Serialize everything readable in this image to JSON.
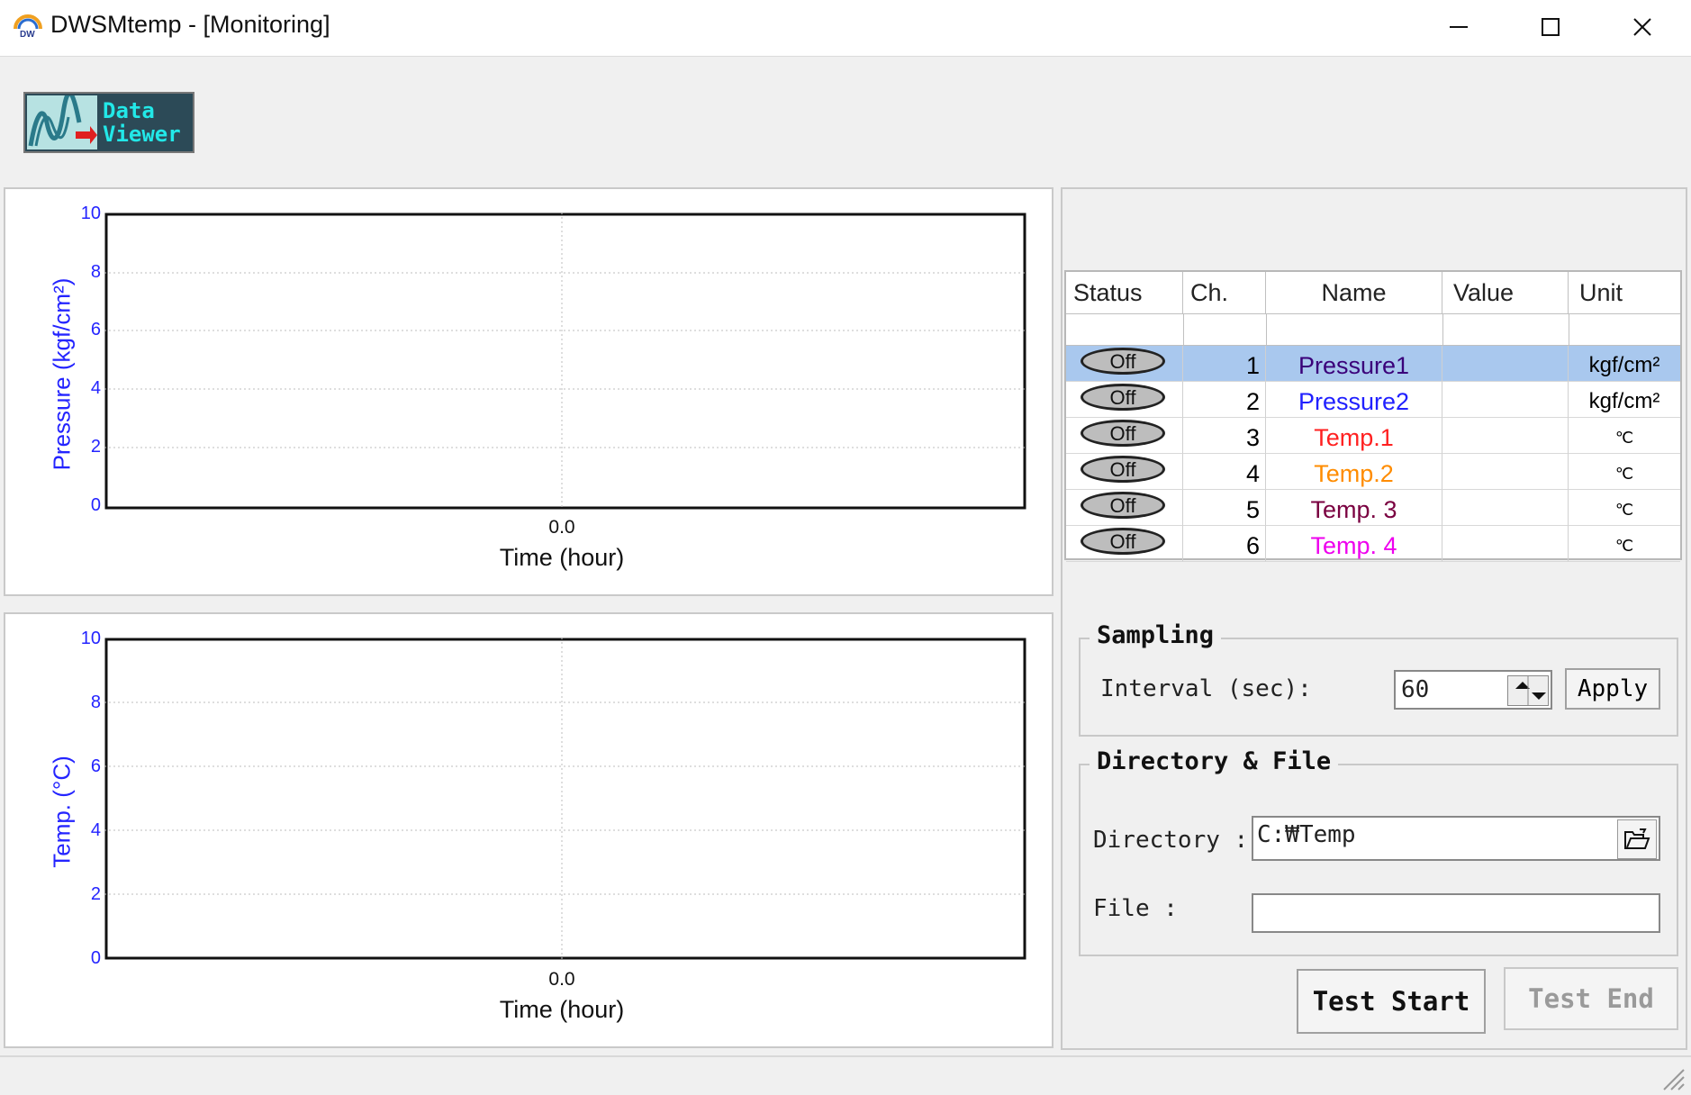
{
  "window": {
    "title": "DWSMtemp - [Monitoring]",
    "app_icon_text": "DW"
  },
  "logo": {
    "line1": "Data",
    "line2": "Viewer"
  },
  "charts": {
    "pressure": {
      "ylabel": "Pressure (kgf/cm²)",
      "xlabel": "Time (hour)",
      "xtick": "0.0",
      "yticks": [
        "10",
        "8",
        "6",
        "4",
        "2",
        "0"
      ]
    },
    "temp": {
      "ylabel": "Temp. (°C)",
      "xlabel": "Time (hour)",
      "xtick": "0.0",
      "yticks": [
        "10",
        "8",
        "6",
        "4",
        "2",
        "0"
      ]
    }
  },
  "chart_data": [
    {
      "type": "line",
      "ylabel": "Pressure (kgf/cm²)",
      "xlabel": "Time (hour)",
      "x_ticks": [
        "0.0"
      ],
      "ylim": [
        0,
        10
      ],
      "y_ticks": [
        0,
        2,
        4,
        6,
        8,
        10
      ],
      "series": [],
      "grid": true
    },
    {
      "type": "line",
      "ylabel": "Temp. (°C)",
      "xlabel": "Time (hour)",
      "x_ticks": [
        "0.0"
      ],
      "ylim": [
        0,
        10
      ],
      "y_ticks": [
        0,
        2,
        4,
        6,
        8,
        10
      ],
      "series": [],
      "grid": true
    }
  ],
  "table": {
    "headers": {
      "status": "Status",
      "ch": "Ch.",
      "name": "Name",
      "value": "Value",
      "unit": "Unit"
    },
    "rows": [
      {
        "status": "Off",
        "ch": "1",
        "name": "Pressure1",
        "value": "",
        "unit": "kgf/cm²",
        "color": "#3a007a"
      },
      {
        "status": "Off",
        "ch": "2",
        "name": "Pressure2",
        "value": "",
        "unit": "kgf/cm²",
        "color": "#2020ff"
      },
      {
        "status": "Off",
        "ch": "3",
        "name": "Temp.1",
        "value": "",
        "unit": "℃",
        "color": "#ff2020"
      },
      {
        "status": "Off",
        "ch": "4",
        "name": "Temp.2",
        "value": "",
        "unit": "℃",
        "color": "#ff8c00"
      },
      {
        "status": "Off",
        "ch": "5",
        "name": "Temp. 3",
        "value": "",
        "unit": "℃",
        "color": "#7a0040"
      },
      {
        "status": "Off",
        "ch": "6",
        "name": "Temp. 4",
        "value": "",
        "unit": "℃",
        "color": "#ee00ee"
      }
    ],
    "selected_row": 0
  },
  "sampling": {
    "legend": "Sampling",
    "interval_label": "Interval (sec):",
    "interval_value": "60",
    "apply_label": "Apply"
  },
  "files": {
    "legend": "Directory & File",
    "directory_label": "Directory :",
    "directory_value": "C:₩Temp",
    "file_label": "File :",
    "file_value": ""
  },
  "actions": {
    "start_label": "Test Start",
    "end_label": "Test End"
  },
  "colors": {
    "axis_text": "#2424ff",
    "selected_row": "#a9c8ee"
  }
}
